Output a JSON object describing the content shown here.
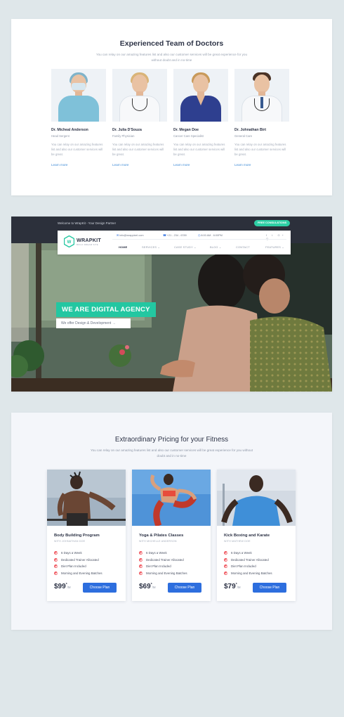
{
  "doctors": {
    "title": "Experienced Team of Doctors",
    "subtitle": "You can relay on our amazing features list and also our customer services will be great experience for you without doubt and in no-time",
    "items": [
      {
        "name": "Dr. Micheal Anderson",
        "role": "Head Sergent",
        "desc": "You can relay on our amazing features list and also our customer services will be great.",
        "link": "Learn more"
      },
      {
        "name": "Dr. Julia D'Souza",
        "role": "Family Physician",
        "desc": "You can relay on our amazing features list and also our customer services will be great.",
        "link": "Learn more"
      },
      {
        "name": "Dr. Megan Doe",
        "role": "Cancer Care Specialist",
        "desc": "You can relay on our amazing features list and also our customer services will be great.",
        "link": "Learn more"
      },
      {
        "name": "Dr. Johnathan Birt",
        "role": "General Care",
        "desc": "You can relay on our amazing features list and also our customer services will be great.",
        "link": "Learn more"
      }
    ]
  },
  "hero": {
    "topbar_text": "Welcome to WrapKit - Your Design Partner",
    "consult_button": "FREE CONSULATIONS",
    "logo_text": "WRAPKIT",
    "logo_tagline": "BUILD DREAM SITE",
    "email": "info@wrappixel.com",
    "phone": "+21 - 234 - 6789",
    "hours": "8:00 AM - 6:00PM",
    "social_icons": [
      "facebook-icon",
      "twitter-icon",
      "google-plus-icon",
      "search-icon"
    ],
    "social_glyphs": "f  t  G+  Q",
    "menu": [
      "HOME",
      "SERVICES",
      "CASE STUDY",
      "BLOG",
      "CONTACT",
      "FEATURES"
    ],
    "headline": "WE ARE DIGITAL AGENCY",
    "cta": "We offer Design & Development",
    "accent_color": "#23c7a1"
  },
  "pricing": {
    "title": "Extraordinary Pricing for your Fitness",
    "subtitle": "You can relay on our amazing features list and also our customer services will be great experience for you without doubt and in no-time",
    "plans": [
      {
        "title": "Body Building Program",
        "with": "WITH JOHNATHAN DOE",
        "features": [
          "6 Days a Week",
          "Dedicated Trainer Allocated",
          "Diet Plan Included",
          "Morning and Evening Batches"
        ],
        "price": "$99",
        "sup": "*",
        "per": "/M",
        "button": "Choose Plan"
      },
      {
        "title": "Yoga & Pilates Classes",
        "with": "WITH MICHELLE ANDERSON",
        "features": [
          "6 Days a Week",
          "Dedicated Trainer Allocated",
          "Diet Plan Included",
          "Morning and Evening Batches"
        ],
        "price": "$69",
        "sup": "*",
        "per": "/M",
        "button": "Choose Plan"
      },
      {
        "title": "Kick Boxing and Karate",
        "with": "WITH MATHEW DOE",
        "features": [
          "6 Days a Week",
          "Dedicated Trainer Allocated",
          "Diet Plan Included",
          "Morning and Evening Batches"
        ],
        "price": "$79",
        "sup": "*",
        "per": "/M",
        "button": "Choose Plan"
      }
    ],
    "button_color": "#2d6ede"
  }
}
